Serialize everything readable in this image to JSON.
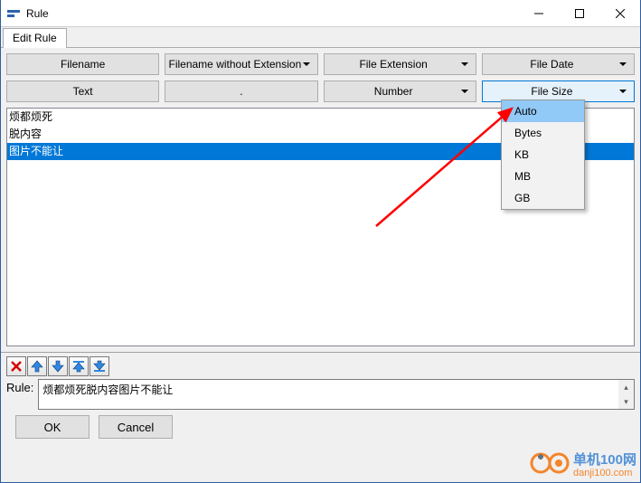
{
  "window": {
    "title": "Rule"
  },
  "tabs": {
    "edit": "Edit Rule"
  },
  "buttons": {
    "r0": [
      "Filename",
      "Filename without Extension",
      "File Extension",
      "File Date"
    ],
    "r1": [
      "Text",
      ".",
      "Number",
      "File Size"
    ]
  },
  "list": {
    "rows": [
      "烦都烦死",
      "脱内容",
      "图片不能让"
    ],
    "selected_index": 2
  },
  "dropdown": {
    "items": [
      "Auto",
      "Bytes",
      "KB",
      "MB",
      "GB"
    ],
    "hover_index": 0
  },
  "rule": {
    "label": "Rule:",
    "value": "烦都烦死脱内容图片不能让"
  },
  "actions": {
    "ok": "OK",
    "cancel": "Cancel"
  },
  "watermark": {
    "cn": "单机100网",
    "url": "danji100.com"
  }
}
